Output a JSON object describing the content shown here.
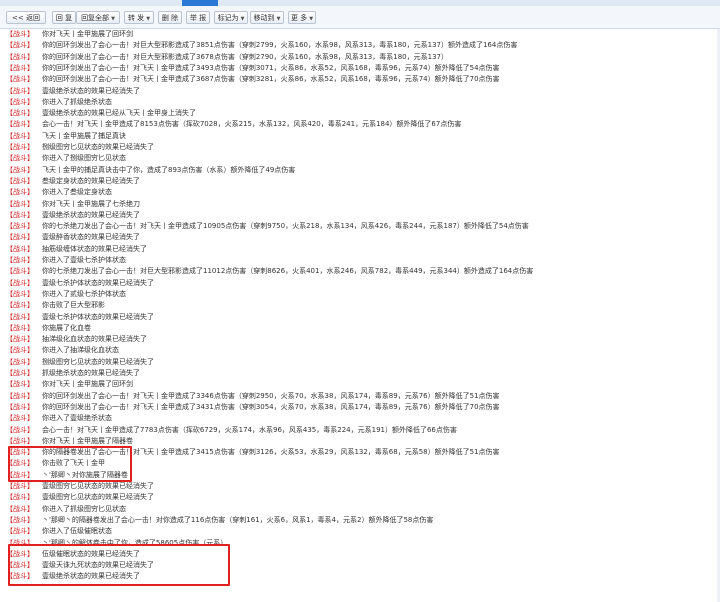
{
  "toolbar": {
    "back": "<< 返回",
    "reply": "回 复",
    "reply_all": "回复全部",
    "forward": "转 发",
    "delete": "删 除",
    "report": "举 报",
    "mark_as": "标记为",
    "move_to": "移动到",
    "more": "更 多"
  },
  "log": {
    "tag": "【战斗】",
    "lines": [
      "你对飞天丨金甲施展了回环剑",
      "你的回环剑发出了会心一击！对巨大型邪影造成了3851点伤害（穿刺2799，火系160，水系98，风系313，毒系180，元系137）额外造成了164点伤害",
      "你的回环剑发出了会心一击！对巨大型邪影造成了3678点伤害（穿刺2790，火系160，水系98，风系313，毒系180，元系137）",
      "你的回环剑发出了会心一击！对飞天丨金甲造成了3493点伤害（穿刺3071，火系86，水系52，风系168，毒系96，元系74）额外降低了54点伤害",
      "你的回环剑发出了会心一击！对飞天丨金甲造成了3687点伤害（穿刺3281，火系86，水系52，风系168，毒系96，元系74）额外降低了70点伤害",
      "壹级绝杀状态的效果已经消失了",
      "你进入了抓级绝杀状态",
      "壹级绝杀状态的效果已经从飞天丨金甲身上消失了",
      "会心一击！对飞天丨金甲造成了8153点伤害（挥砍7028，火系215，水系132，风系420，毒系241，元系184）额外降低了67点伤害",
      "飞天丨金甲施展了捕足真诀",
      "捌级图穷匕见状态的效果已经消失了",
      "你进入了捌级图穷匕见状态",
      "飞天丨金甲的捕足真诀击中了你，造成了893点伤害（水系）额外降低了49点伤害",
      "叁级定身状态的效果已经消失了",
      "你进入了叁级定身状态",
      "你对飞天丨金甲施展了七杀绝刀",
      "壹级绝杀状态的效果已经消失了",
      "你的七杀绝刀发出了会心一击！对飞天丨金甲造成了10905点伤害（穿刺9750，火系218，水系134，风系426，毒系244，元系187）额外降低了54点伤害",
      "壹级醉香状态的效果已经消失了",
      "抽筋级缠体状态的效果已经消失了",
      "你进入了壹级七杀护体状态",
      "你的七杀绝刀发出了会心一击！对巨大型邪影造成了11012点伤害（穿刺8626，火系401，水系246，风系782，毒系449，元系344）额外造成了164点伤害",
      "壹级七杀护体状态的效果已经消失了",
      "你进入了贰级七杀护体状态",
      "你击败了巨大型邪影",
      "壹级七杀护体状态的效果已经消失了",
      "你施展了化血卷",
      "抽涕级化血状态的效果已经消失了",
      "你进入了抽涕级化血状态",
      "捌级图穷匕见状态的效果已经消失了",
      "抓级绝杀状态的效果已经消失了",
      "你对飞天丨金甲施展了回环剑",
      "你的回环剑发出了会心一击！对飞天丨金甲造成了3346点伤害（穿刺2950，火系70，水系38，风系174，毒系89，元系76）额外降低了51点伤害",
      "你的回环剑发出了会心一击！对飞天丨金甲造成了3431点伤害（穿刺3054，火系70，水系38，风系174，毒系89，元系76）额外降低了70点伤害",
      "你进入了壹级绝杀状态",
      "会心一击！对飞天丨金甲造成了7783点伤害（挥砍6729，火系174，水系96，风系435，毒系224，元系191）额外降低了66点伤害",
      "你对飞天丨金甲施展了隔器卷",
      "你的隔器卷发出了会心一击！对飞天丨金甲造成了3415点伤害（穿刺3126，火系53，水系29，风系132，毒系68，元系58）额外降低了51点伤害",
      "你击败了飞天丨金甲",
      "丶'那卿丶对你施展了隔器卷",
      "壹级图穷匕见状态的效果已经消失了",
      "壹级图穷匕见状态的效果已经消失了",
      "你进入了抓级图穷匕见状态",
      "丶'那卿丶的隔器卷发出了会心一击！对你造成了116点伤害（穿刺161，火系6，风系1，毒系4，元系2）额外降低了58点伤害",
      "你进入了伍级催眠状态",
      "丶'那卿丶的解体卷击中了你，造成了58605点伤害（元系）",
      "伍级催眠状态的效果已经消失了",
      "壹级天诛九死状态的效果已经消失了",
      "壹级绝杀状态的效果已经消失了"
    ]
  }
}
